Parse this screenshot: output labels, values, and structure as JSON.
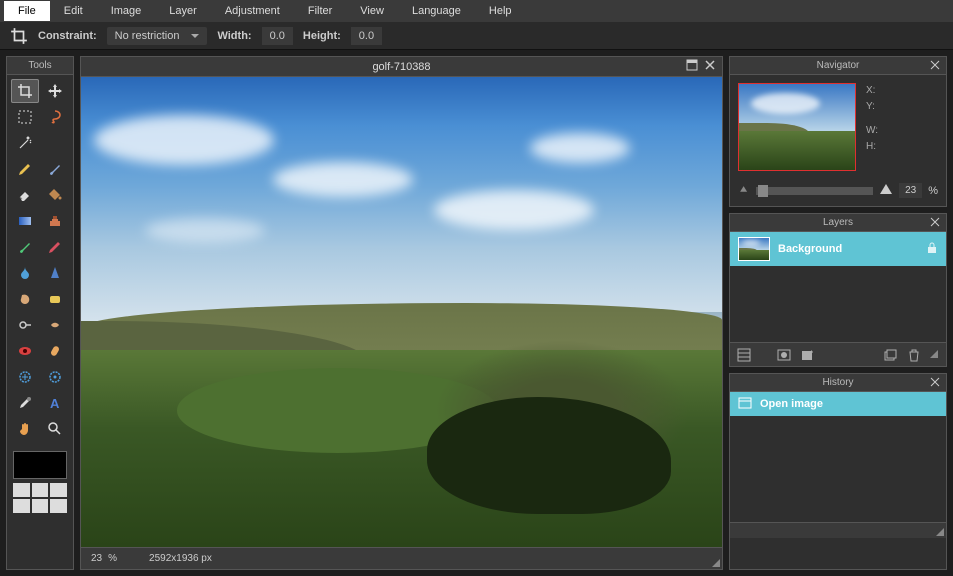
{
  "menu": [
    "File",
    "Edit",
    "Image",
    "Layer",
    "Adjustment",
    "Filter",
    "View",
    "Language",
    "Help"
  ],
  "activeMenu": 0,
  "optbar": {
    "constraint_label": "Constraint",
    "constraint_value": "No restriction",
    "width_label": "Width",
    "width_value": "0.0",
    "height_label": "Height",
    "height_value": "0.0"
  },
  "tools_title": "Tools",
  "canvas": {
    "title": "golf-710388",
    "zoom": "23",
    "zoom_unit": "%",
    "dims": "2592x1936 px"
  },
  "navigator": {
    "title": "Navigator",
    "x_label": "X:",
    "y_label": "Y:",
    "w_label": "W:",
    "h_label": "H:",
    "zoom": "23",
    "zoom_unit": "%"
  },
  "layers": {
    "title": "Layers",
    "items": [
      {
        "name": "Background",
        "locked": true
      }
    ]
  },
  "history": {
    "title": "History",
    "items": [
      {
        "label": "Open image"
      }
    ]
  }
}
